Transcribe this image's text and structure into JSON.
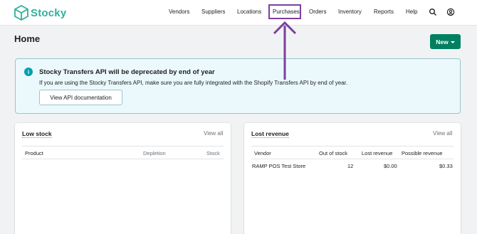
{
  "brand": {
    "name": "Stocky",
    "color": "#2eb19a"
  },
  "nav": {
    "items": [
      "Vendors",
      "Suppliers",
      "Locations",
      "Purchases",
      "Orders",
      "Inventory",
      "Reports",
      "Help"
    ],
    "highlighted": "Purchases",
    "icons": [
      "search-icon",
      "account-icon"
    ]
  },
  "page": {
    "title": "Home",
    "new_button": "New"
  },
  "banner": {
    "title": "Stocky Transfers API will be deprecated by end of year",
    "text": "If you are using the Stocky Transfers API, make sure you are fully integrated with the Shopify Transfers API by end of year.",
    "button": "View API documentation",
    "icon": "info-icon"
  },
  "low_stock": {
    "title": "Low stock",
    "view_all": "View all",
    "columns": [
      "Product",
      "Depletion",
      "Stock"
    ]
  },
  "lost_revenue": {
    "title": "Lost revenue",
    "view_all": "View all",
    "columns": [
      "Vendor",
      "Out of stock",
      "Lost revenue",
      "Possible revenue"
    ],
    "rows": [
      {
        "vendor": "RAMP POS Test Store",
        "out_of_stock": "12",
        "lost_revenue": "$0.00",
        "possible_revenue": "$0.33"
      }
    ]
  },
  "colors": {
    "primary": "#008060",
    "annotation": "#7b3fa0",
    "banner_bg": "#ebf9fc"
  }
}
